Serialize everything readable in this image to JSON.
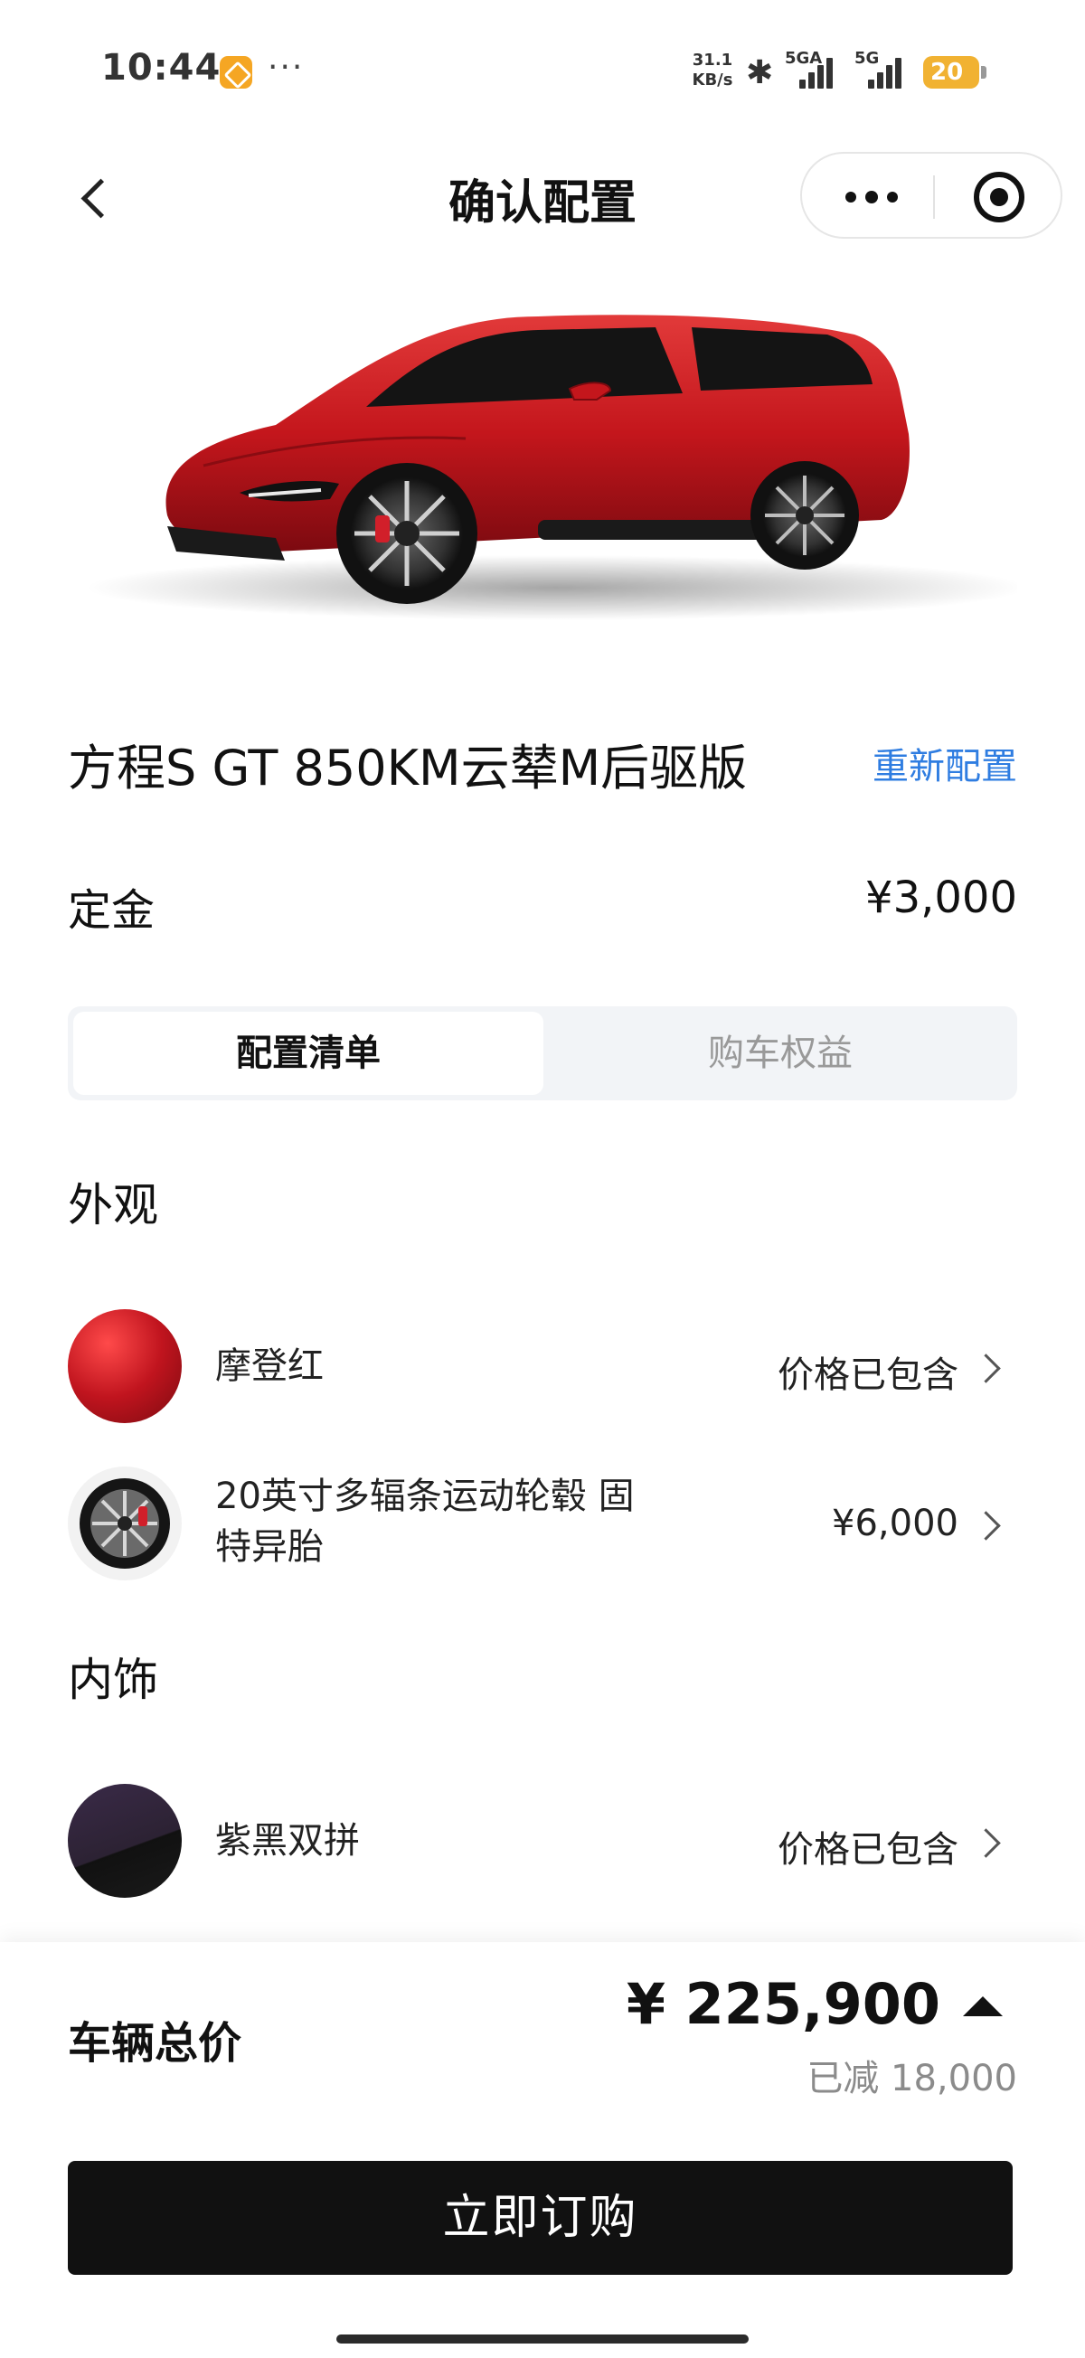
{
  "status_bar": {
    "time": "10:44",
    "more": "···",
    "speed_value": "31.1",
    "speed_unit": "KB/s",
    "net1": "5GA",
    "net2": "5G",
    "battery": "20"
  },
  "nav": {
    "title": "确认配置"
  },
  "car": {
    "name": "方程S GT 850KM云辇M后驱版",
    "reconfigure_label": "重新配置",
    "deposit_label": "定金",
    "deposit_value": "¥3,000"
  },
  "tabs": [
    {
      "label": "配置清单",
      "active": true
    },
    {
      "label": "购车权益",
      "active": false
    }
  ],
  "sections": {
    "exterior_title": "外观",
    "interior_title": "内饰"
  },
  "options": {
    "paint": {
      "label": "摩登红",
      "price": "价格已包含",
      "color": "#c0141e"
    },
    "wheel": {
      "label_line1": "20英寸多辐条运动轮毂 固",
      "label_line2": "特异胎",
      "price": "¥6,000"
    },
    "interior": {
      "label": "紫黑双拼",
      "price": "价格已包含",
      "color": "#2c2233"
    }
  },
  "bottom": {
    "total_label": "车辆总价",
    "total_price": "¥ 225,900",
    "discount": "已减 18,000",
    "buy_label": "立即订购"
  },
  "colors": {
    "accent_link": "#2f7de1",
    "button_bg": "#111111",
    "car_body": "#c4161c"
  },
  "icons": [
    "back-icon",
    "more-icon",
    "close-miniprogram-icon",
    "chevron-right-icon",
    "caret-up-icon"
  ]
}
